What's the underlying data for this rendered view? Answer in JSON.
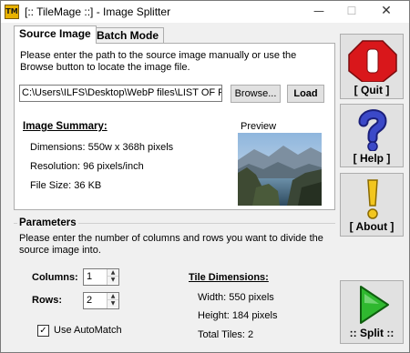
{
  "window": {
    "title": "[:: TileMage ::] - Image Splitter",
    "app_icon_text": "TM",
    "controls": {
      "minimize": "—",
      "maximize": "☐",
      "close": "✕"
    }
  },
  "tabs": [
    {
      "label": "Source Image",
      "active": true
    },
    {
      "label": "Batch Mode",
      "active": false
    }
  ],
  "source": {
    "instructions": "Please enter the path to the source image manually or use the Browse button to locate the image file.",
    "path_value": "C:\\Users\\ILFS\\Desktop\\WebP files\\LIST OF FRE",
    "browse_label": "Browse...",
    "load_label": "Load"
  },
  "summary": {
    "heading": "Image Summary:",
    "dimensions": "Dimensions: 550w x 368h pixels",
    "resolution": "Resolution: 96 pixels/inch",
    "file_size": "File Size: 36 KB",
    "preview_label": "Preview"
  },
  "parameters": {
    "title": "Parameters",
    "instructions": "Please enter the number of columns and rows you want to divide the source image into.",
    "columns_label": "Columns:",
    "columns_value": "1",
    "rows_label": "Rows:",
    "rows_value": "2",
    "automatch_label": "Use AutoMatch",
    "automatch_checked": true
  },
  "tile_dimensions": {
    "heading": "Tile Dimensions:",
    "width": "Width: 550 pixels",
    "height": "Height: 184 pixels",
    "total": "Total Tiles: 2"
  },
  "actions": {
    "quit": "[ Quit ]",
    "help": "[ Help ]",
    "about": "[ About ]",
    "split": ":: Split ::"
  },
  "colors": {
    "quit_red": "#d9171b",
    "help_blue": "#3b49c8",
    "about_yellow": "#f2c61f",
    "split_green": "#2fb82f"
  }
}
